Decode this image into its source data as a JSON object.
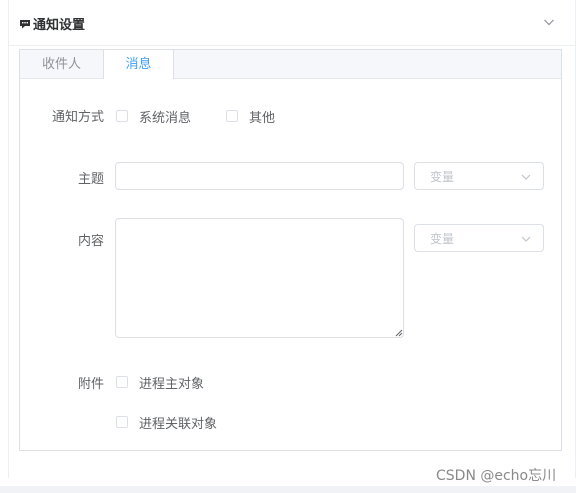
{
  "header": {
    "title": "通知设置",
    "title_icon": "message-icon",
    "collapse_icon": "chevron-down-icon"
  },
  "tabs": [
    {
      "label": "收件人",
      "active": false
    },
    {
      "label": "消息",
      "active": true
    }
  ],
  "form": {
    "notify_method": {
      "label": "通知方式",
      "options": [
        {
          "label": "系统消息",
          "checked": false
        },
        {
          "label": "其他",
          "checked": false
        }
      ]
    },
    "subject": {
      "label": "主题",
      "value": "",
      "variable_placeholder": "变量"
    },
    "content": {
      "label": "内容",
      "value": "",
      "variable_placeholder": "变量"
    },
    "attachment": {
      "label": "附件",
      "options": [
        {
          "label": "进程主对象",
          "checked": false
        },
        {
          "label": "进程关联对象",
          "checked": false
        }
      ]
    }
  },
  "colors": {
    "accent": "#409eff",
    "border": "#dcdfe6",
    "tab_bg": "#f5f7fa"
  },
  "watermark": "CSDN @echo忘川"
}
